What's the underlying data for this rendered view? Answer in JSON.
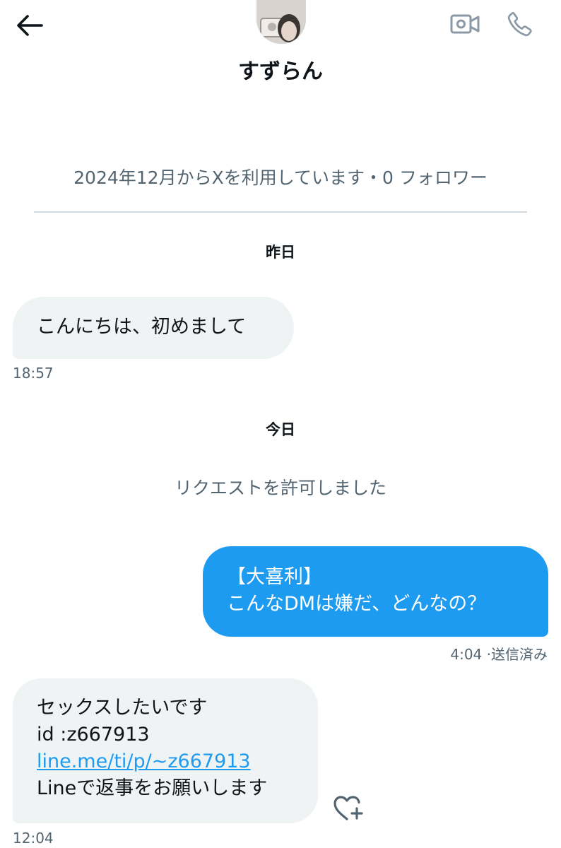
{
  "header": {
    "back_icon": "arrow-left-icon",
    "avatar": "user-avatar-photo",
    "video_icon": "video-camera-icon",
    "call_icon": "phone-icon",
    "display_name": "すずらん"
  },
  "profile_meta": "2024年12月からXを利用しています・0 フォロワー",
  "conversation": {
    "day_yesterday": "昨日",
    "message1": {
      "text": "こんにちは、初めまして",
      "time": "18:57"
    },
    "day_today": "今日",
    "system_message": "リクエストを許可しました",
    "message2": {
      "line1": "【大喜利】",
      "line2": "こんなDMは嫌だ、どんなの？",
      "status": "4:04 ·送信済み"
    },
    "message3": {
      "line1": "セックスしたいです",
      "line2": "id :z667913",
      "link": "line.me/ti/p/~z667913",
      "line4": "Lineで返事をお願いします",
      "time": "12:04"
    },
    "react_icon": "heart-plus-icon"
  },
  "colors": {
    "accent": "#1d9bf0",
    "bubble_in": "#eff3f4",
    "secondary_text": "#536471",
    "primary_text": "#0f1419"
  }
}
